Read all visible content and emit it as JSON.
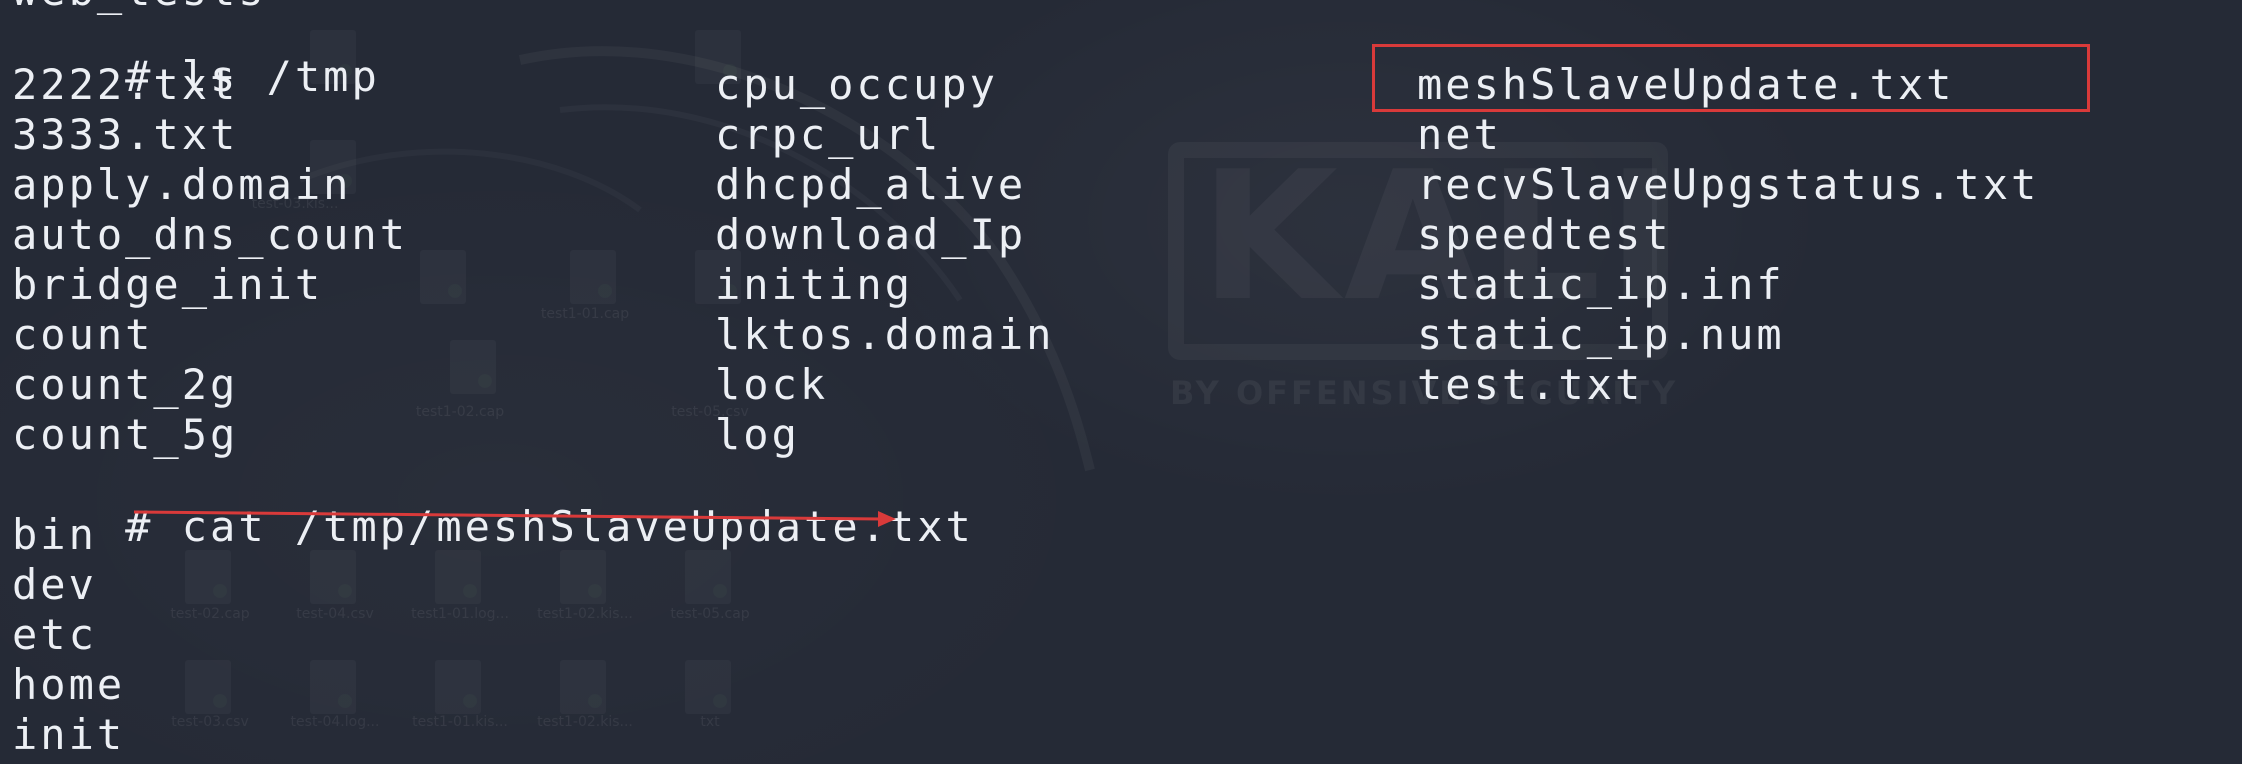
{
  "terminal": {
    "partial_top_line": "web_tests",
    "command_ls": {
      "prompt": "#",
      "command": "ls /tmp"
    },
    "ls_columns": [
      [
        "2222.txt",
        "3333.txt",
        "apply.domain",
        "auto_dns_count",
        "bridge_init",
        "count",
        "count_2g",
        "count_5g"
      ],
      [
        "cpu_occupy",
        "crpc_url",
        "dhcpd_alive",
        "download_Ip",
        "initing",
        "lktos.domain",
        "lock",
        "log"
      ],
      [
        "meshSlaveUpdate.txt",
        "net",
        "recvSlaveUpgstatus.txt",
        "speedtest",
        "static_ip.inf",
        "static_ip.num",
        "test.txt"
      ]
    ],
    "command_cat": {
      "prompt": "#",
      "command": "cat /tmp/meshSlaveUpdate.txt"
    },
    "cat_output": [
      "bin",
      "dev",
      "etc",
      "home",
      "init"
    ]
  },
  "background": {
    "logo_word": "KALI",
    "logo_subtitle": "BY OFFENSIVE SECURITY",
    "desktop_labels": [
      "test-02.cap",
      "test-04.csv",
      "test1-01.log...",
      "test1-02.kis...",
      "test-05.cap",
      "test-03.csv",
      "test-04.log...",
      "test1-01.kis...",
      "test1-02.kis...",
      "txt",
      "test-03.kis...",
      "test1-01.cap",
      "test1-02.cap",
      "test-05.csv"
    ]
  },
  "colors": {
    "background": "#252a36",
    "text": "#eceff4",
    "annotation": "#d93a3a"
  }
}
